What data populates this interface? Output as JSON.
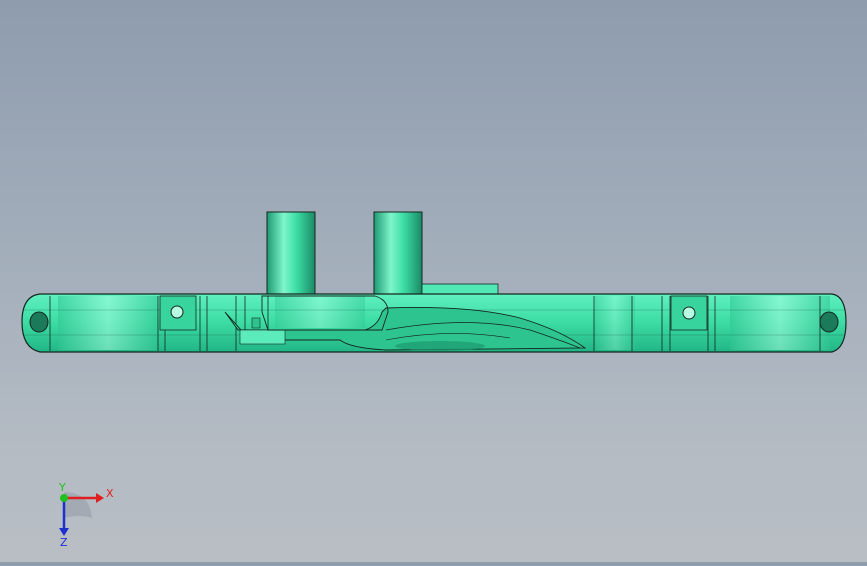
{
  "viewport": {
    "background_top": "#8e9cae",
    "background_bottom": "#b9bec4"
  },
  "model": {
    "color": "#3fe0a8",
    "edge_color": "#1a2a24"
  },
  "triad": {
    "x_label": "X",
    "y_label": "Y",
    "z_label": "Z",
    "x_color": "#e02020",
    "y_color": "#20c020",
    "z_color": "#2030d0"
  }
}
